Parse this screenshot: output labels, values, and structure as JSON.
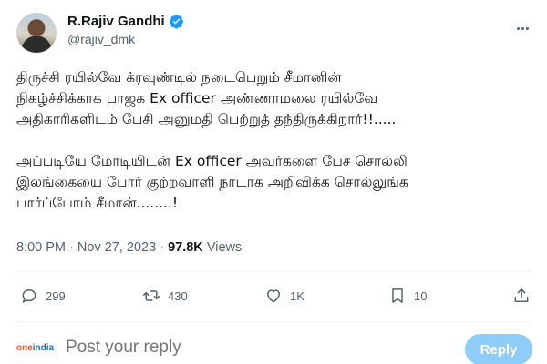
{
  "author": {
    "name": "R.Rajiv Gandhi",
    "handle": "@rajiv_dmk",
    "verified": true
  },
  "tweet": {
    "paragraph1": [
      "திருச்சி ரயில்வே க்ரவுண்டில் நடைபெறும் சீமானின்",
      "நிகழ்ச்சிக்காக பாஜக Ex officer அண்ணாமலை ரயில்வே",
      "அதிகாரிகளிடம் பேசி அனுமதி பெற்றுத் தந்திருக்கிறார்!!....."
    ],
    "paragraph2": [
      "அப்படியே மோடியிடன் Ex officer அவர்களை பேச சொல்லி",
      "இலங்கையை போர் குற்றவாளி நாடாக அறிவிக்க சொல்லுங்க",
      "பார்ப்போம் சீமான்........!"
    ]
  },
  "meta": {
    "time": "8:00 PM",
    "separator": "·",
    "date": "Nov 27, 2023",
    "views_count": "97.8K",
    "views_label": "Views"
  },
  "actions": {
    "replies": "299",
    "retweets": "430",
    "likes": "1K",
    "bookmarks": "10"
  },
  "reply_bar": {
    "avatar_text_1": "one",
    "avatar_text_2": "india",
    "placeholder": "Post your reply",
    "button_label": "Reply"
  },
  "colors": {
    "verified": "#1d9bf0",
    "reply_button": "#8ecdf7",
    "secondary_text": "#536471"
  }
}
